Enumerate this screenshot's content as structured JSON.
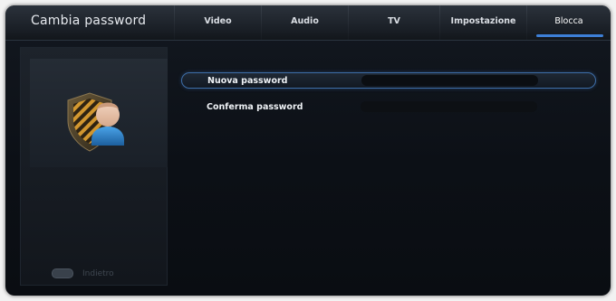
{
  "header": {
    "title": "Cambia password",
    "tabs": [
      {
        "label": "Video",
        "active": false
      },
      {
        "label": "Audio",
        "active": false
      },
      {
        "label": "TV",
        "active": false
      },
      {
        "label": "Impostazione",
        "active": false
      },
      {
        "label": "Blocca",
        "active": true
      }
    ]
  },
  "sidebar": {
    "icon": "user-shield-icon",
    "back_button_icon": "back-button-icon",
    "back_label": "Indietro"
  },
  "form": {
    "new_password_label": "Nuova password",
    "confirm_password_label": "Conferma password"
  },
  "colors": {
    "accent": "#3d7fd6",
    "background": "#0c1016",
    "text": "#eef1f5"
  }
}
